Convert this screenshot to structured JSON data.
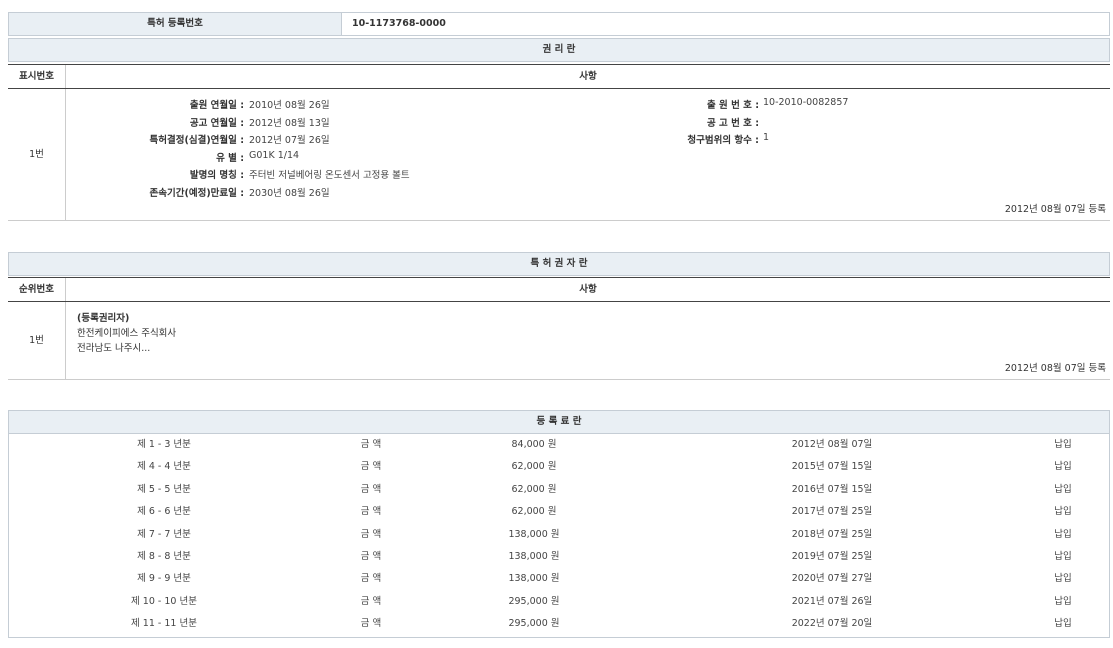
{
  "reg_no": {
    "label": "특허 등록번호",
    "value": "10-1173768-0000"
  },
  "rights": {
    "title": "권 리 란",
    "col_no": "표시번호",
    "col_content": "사항",
    "row_no": "1번",
    "left": [
      {
        "k": "출원 연월일 :",
        "v": "2010년 08월 26일"
      },
      {
        "k": "공고 연월일 :",
        "v": "2012년 08월 13일"
      },
      {
        "k": "특허결정(심결)연월일 :",
        "v": "2012년 07월 26일"
      },
      {
        "k": "유 별 :",
        "v": "G01K 1/14"
      },
      {
        "k": "발명의 명칭 :",
        "v": "주터빈 저널베어링 온도센서 고정용 볼트"
      },
      {
        "k": "존속기간(예정)만료일 :",
        "v": "2030년 08월 26일"
      }
    ],
    "right": [
      {
        "k": "출 원 번 호 :",
        "v": "10-2010-0082857"
      },
      {
        "k": "공 고 번 호 :",
        "v": ""
      },
      {
        "k": "청구범위의 항수 :",
        "v": "1"
      }
    ],
    "reg_note": "2012년 08월 07일 등록"
  },
  "holders": {
    "title": "특 허 권 자 란",
    "col_no": "순위번호",
    "col_content": "사항",
    "row_no": "1번",
    "lines": [
      "(등록권리자)",
      "한전케이피에스 주식회사",
      "전라남도 나주시..."
    ],
    "reg_note": "2012년 08월 07일 등록"
  },
  "fees": {
    "title": "등 록 료 란",
    "rows": [
      {
        "period": "제 1 - 3 년분",
        "label": "금 액",
        "amount": "84,000 원",
        "date": "2012년 08월 07일",
        "status": "납입"
      },
      {
        "period": "제 4 - 4 년분",
        "label": "금 액",
        "amount": "62,000 원",
        "date": "2015년 07월 15일",
        "status": "납입"
      },
      {
        "period": "제 5 - 5 년분",
        "label": "금 액",
        "amount": "62,000 원",
        "date": "2016년 07월 15일",
        "status": "납입"
      },
      {
        "period": "제 6 - 6 년분",
        "label": "금 액",
        "amount": "62,000 원",
        "date": "2017년 07월 25일",
        "status": "납입"
      },
      {
        "period": "제 7 - 7 년분",
        "label": "금 액",
        "amount": "138,000 원",
        "date": "2018년 07월 25일",
        "status": "납입"
      },
      {
        "period": "제 8 - 8 년분",
        "label": "금 액",
        "amount": "138,000 원",
        "date": "2019년 07월 25일",
        "status": "납입"
      },
      {
        "period": "제 9 - 9 년분",
        "label": "금 액",
        "amount": "138,000 원",
        "date": "2020년 07월 27일",
        "status": "납입"
      },
      {
        "period": "제 10 - 10 년분",
        "label": "금 액",
        "amount": "295,000 원",
        "date": "2021년 07월 26일",
        "status": "납입"
      },
      {
        "period": "제 11 - 11 년분",
        "label": "금 액",
        "amount": "295,000 원",
        "date": "2022년 07월 20일",
        "status": "납입"
      }
    ]
  }
}
